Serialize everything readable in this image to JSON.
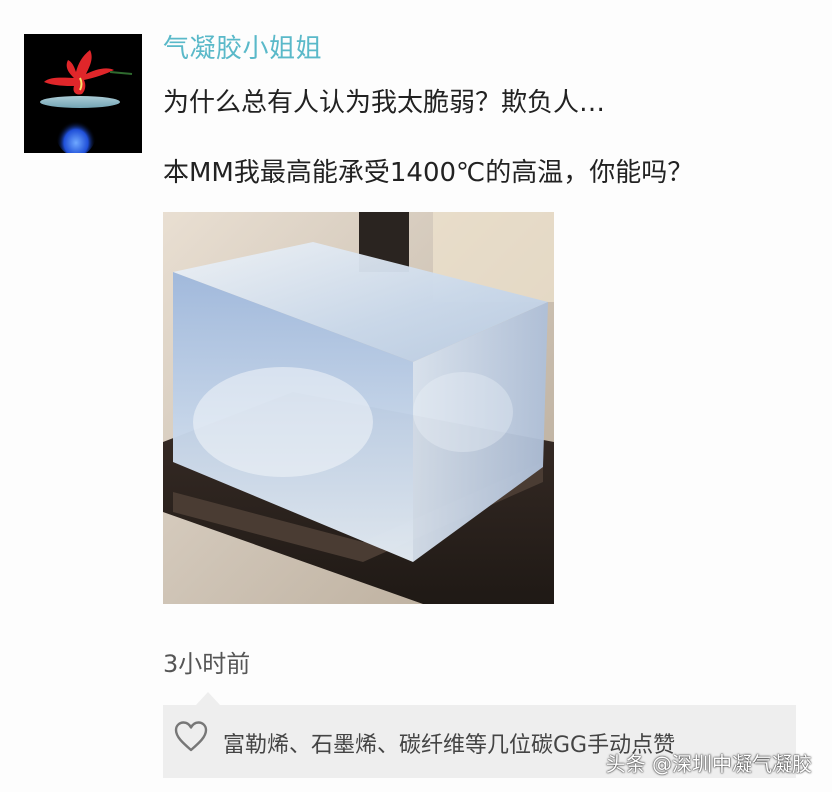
{
  "post": {
    "author": "气凝胶小姐姐",
    "line1": "为什么总有人认为我太脆弱？欺负人…",
    "line2": "本MM我最高能承受1400℃的高温，你能吗？",
    "timestamp": "3小时前"
  },
  "likes": {
    "icon": "heart-outline-icon",
    "text": "富勒烯、石墨烯、碳纤维等几位碳GG手动点赞"
  },
  "watermark": "头条 @深圳中凝气凝胶",
  "colors": {
    "author": "#5ab9c9",
    "like_bar_bg": "#eeeeee",
    "body_text": "#222222",
    "meta_text": "#555555"
  }
}
